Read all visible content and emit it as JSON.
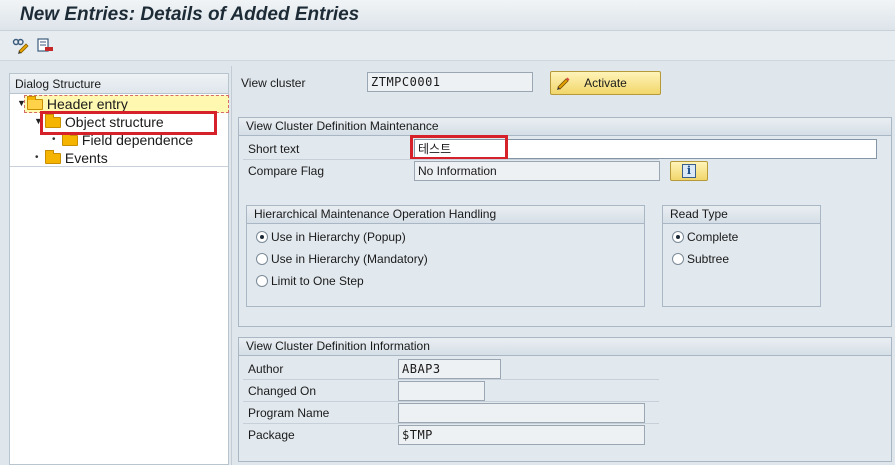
{
  "window": {
    "title": "New Entries: Details of Added Entries"
  },
  "toolbar": {
    "icons": [
      "display-change-icon",
      "delete-row-icon"
    ]
  },
  "dialog_structure": {
    "header": "Dialog Structure",
    "items": [
      {
        "label": "Header entry",
        "level": 0,
        "expanded": true,
        "selected": true
      },
      {
        "label": "Object structure",
        "level": 1,
        "expanded": true
      },
      {
        "label": "Field dependence",
        "level": 2
      },
      {
        "label": "Events",
        "level": 1
      }
    ]
  },
  "header": {
    "view_cluster_label": "View cluster",
    "view_cluster_value": "ZTMPC0001",
    "activate_label": "Activate"
  },
  "maintenance": {
    "title": "View Cluster Definition Maintenance",
    "short_text_label": "Short text",
    "short_text_value": "테스트",
    "compare_flag_label": "Compare Flag",
    "compare_flag_value": "No Information",
    "hierarchical": {
      "title": "Hierarchical Maintenance Operation Handling",
      "options": [
        "Use in Hierarchy (Popup)",
        "Use in Hierarchy (Mandatory)",
        "Limit to One Step"
      ],
      "selected": "Use in Hierarchy (Popup)"
    },
    "read_type": {
      "title": "Read Type",
      "options": [
        "Complete",
        "Subtree"
      ],
      "selected": "Complete"
    }
  },
  "information": {
    "title": "View Cluster Definition Information",
    "author_label": "Author",
    "author_value": "ABAP3",
    "changed_on_label": "Changed On",
    "changed_on_value": "",
    "program_name_label": "Program Name",
    "program_name_value": "",
    "package_label": "Package",
    "package_value": "$TMP"
  },
  "colors": {
    "background": "#dfe6ec",
    "highlight_box": "#d6202a",
    "button_yellow": "#f1d66b",
    "selected_row": "#fff8b0"
  }
}
